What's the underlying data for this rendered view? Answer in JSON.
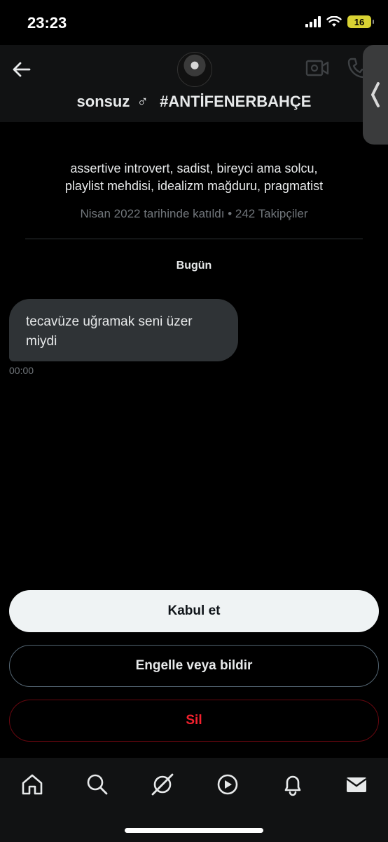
{
  "status_bar": {
    "time": "23:23",
    "battery": "16",
    "icons": [
      "signal-icon",
      "wifi-icon",
      "battery-icon"
    ]
  },
  "header": {
    "display_name": "sonsuz",
    "gender_symbol": "♂",
    "hashtag": "#ANTİFENERBAHÇE",
    "icons": [
      "back-arrow-icon",
      "video-call-icon",
      "phone-icon"
    ]
  },
  "profile": {
    "bio_line1": "assertive introvert, sadist, bireyci ama solcu,",
    "bio_line2": "playlist mehdisi, idealizm mağduru, pragmatist",
    "joined": "Nisan 2022 tarihinde katıldı • 242 Takipçiler"
  },
  "conversation": {
    "day_label": "Bugün",
    "messages": [
      {
        "text": "tecavüze uğramak seni üzer miydi",
        "time": "00:00"
      }
    ]
  },
  "actions": {
    "accept": "Kabul et",
    "block_report": "Engelle veya bildir",
    "delete": "Sil"
  },
  "tabbar": {
    "icons": [
      "home-icon",
      "search-icon",
      "grok-icon",
      "video-icon",
      "notifications-icon",
      "messages-icon"
    ]
  },
  "colors": {
    "background": "#000000",
    "text": "#e7e9ea",
    "muted": "#71767b",
    "bubble": "#2f3336",
    "danger": "#f4212e",
    "battery": "#d8d233"
  }
}
